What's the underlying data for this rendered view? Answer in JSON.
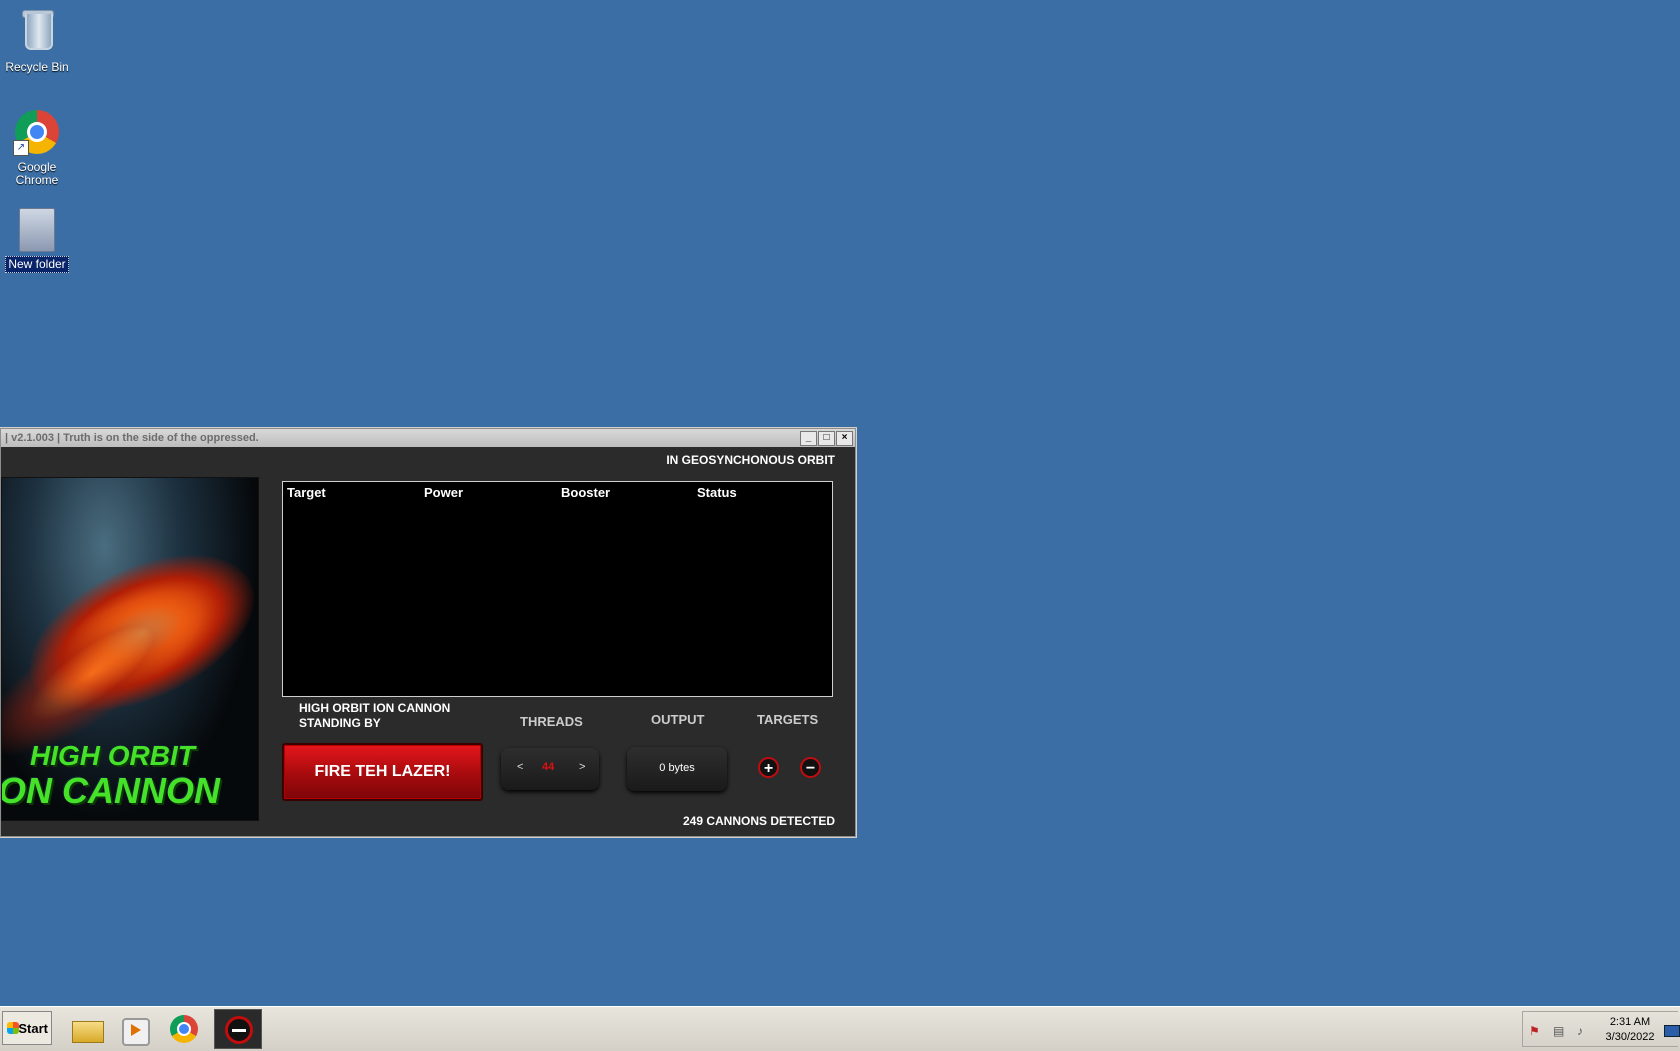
{
  "desktop": {
    "icons": [
      {
        "label": "Recycle Bin"
      },
      {
        "label": "Google Chrome"
      },
      {
        "label": "New folder"
      }
    ]
  },
  "window": {
    "title": "| v2.1.003 | Truth is on the side of the oppressed.",
    "controls": {
      "minimize": "_",
      "maximize": "□",
      "close": "×"
    },
    "orbit_status": "IN GEOSYNCHONOUS ORBIT",
    "logo": {
      "line1": "HIGH ORBIT",
      "line2": "ON CANNON"
    },
    "list_columns": [
      "Target",
      "Power",
      "Booster",
      "Status"
    ],
    "standby_text": "HIGH ORBIT ION CANNON STANDING BY",
    "fire_button": "FIRE TEH LAZER!",
    "threads": {
      "label": "THREADS",
      "decrement": "<",
      "value": "44",
      "increment": ">"
    },
    "output": {
      "label": "OUTPUT",
      "value": "0 bytes"
    },
    "targets": {
      "label": "TARGETS",
      "add": "+",
      "remove": "−"
    },
    "cannons_detected": "249 CANNONS DETECTED"
  },
  "taskbar": {
    "start_label": "Start",
    "pinned": [
      "windows-explorer-icon",
      "media-player-icon",
      "chrome-icon",
      "loic-icon"
    ],
    "clock": {
      "time": "2:31 AM",
      "date": "3/30/2022"
    }
  },
  "colors": {
    "desktop": "#3a6ea5",
    "accent_red": "#c10d0d",
    "logo_green": "#46e22a"
  }
}
